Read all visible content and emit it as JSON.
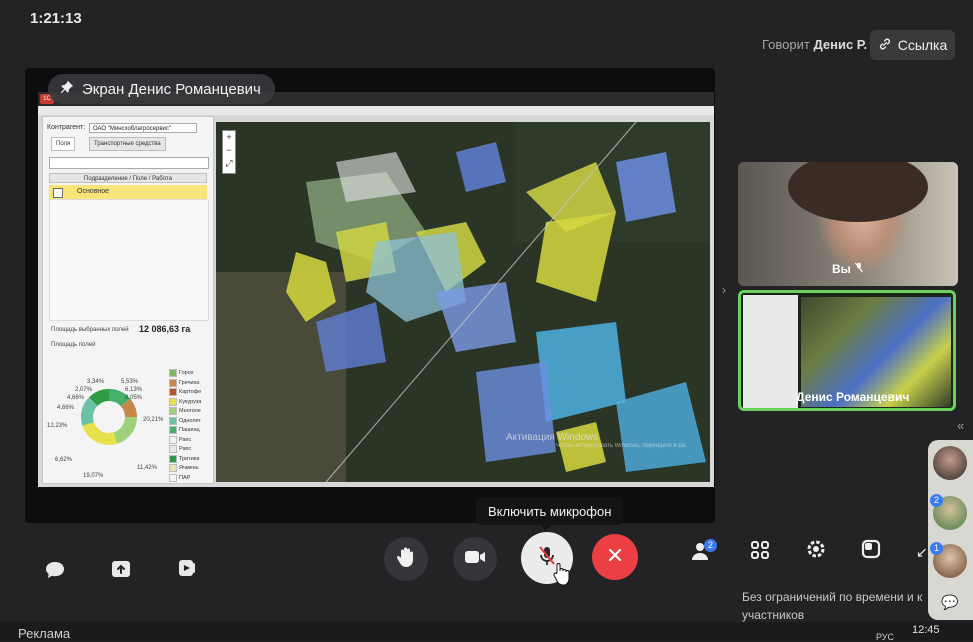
{
  "header": {
    "time": "1:21:13",
    "speaking_prefix": "Говорит",
    "speaking_name": "Денис Р.",
    "link_button": "Ссылка"
  },
  "screen_share": {
    "label": "Экран Денис Романцевич",
    "app": {
      "contractor_label": "Контрагент:",
      "contractor_value": "ОАО \"Минсхоблагросервис\"",
      "tab_fields": "Поля",
      "tab_vehicles": "Транспортные средства",
      "tree_header": "Подразделение / Поле / Работа",
      "tree_selected": "Основное",
      "selected_area_label": "Площадь выбранных полей",
      "selected_area_value": "12 086,63 га",
      "fields_area_label": "Площадь полей",
      "pie_labels": [
        "3,34%",
        "5,53%",
        "2,07%",
        "6,13%",
        "4,66%",
        "8,05%",
        "4,66%",
        "20,21%",
        "12,23%",
        "6,62%",
        "11,42%",
        "19,07%"
      ],
      "legend": [
        {
          "label": "Горох",
          "color": "#7bb661"
        },
        {
          "label": "Гречиха",
          "color": "#c8874a"
        },
        {
          "label": "Картофе",
          "color": "#b5552f"
        },
        {
          "label": "Кукуруза",
          "color": "#e6e04a"
        },
        {
          "label": "Многоле",
          "color": "#9fd07a"
        },
        {
          "label": "Однолет",
          "color": "#6cc2a6"
        },
        {
          "label": "Пашенц",
          "color": "#45b06a"
        },
        {
          "label": "Рапс",
          "color": "#f2f2f2"
        },
        {
          "label": "Рапс",
          "color": "#e8e8e8"
        },
        {
          "label": "Тритика",
          "color": "#2f9c44"
        },
        {
          "label": "Ячмень",
          "color": "#e9e3b4"
        },
        {
          "label": "ПАР",
          "color": "#f6f6f6"
        }
      ]
    },
    "watermark_title": "Активация Windows",
    "watermark_sub": "Чтобы активировать Windows, перейдите в раздел «Параметры»."
  },
  "tooltip": "Включить микрофон",
  "participants": {
    "self_label": "Вы",
    "presenter_name": "Денис Романцевич",
    "badge_counts": [
      "2",
      "1"
    ]
  },
  "controls": {
    "participants_badge": "2"
  },
  "footer": {
    "promo_line1": "Без ограничений по времени и к",
    "promo_line2": "участников",
    "ad_label": "Реклама",
    "tray_lang": "РУС",
    "tray_time": "12:45"
  }
}
